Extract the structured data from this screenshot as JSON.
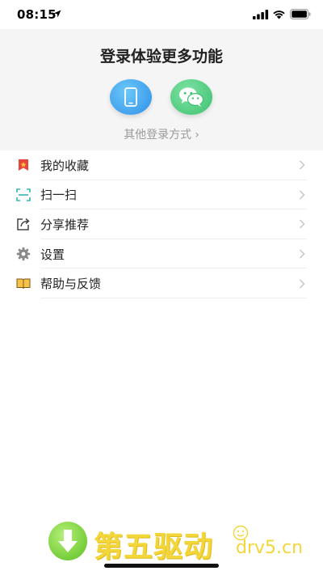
{
  "status_bar": {
    "time": "08:15",
    "icons": [
      "location-arrow-icon",
      "signal-icon",
      "wifi-icon",
      "battery-icon"
    ]
  },
  "login": {
    "title": "登录体验更多功能",
    "phone_icon": "phone-icon",
    "wechat_icon": "wechat-icon",
    "other_methods": "其他登录方式",
    "chevron": "›"
  },
  "menu": {
    "items": [
      {
        "label": "我的收藏",
        "icon": "bookmark-icon"
      },
      {
        "label": "扫一扫",
        "icon": "scan-icon"
      },
      {
        "label": "分享推荐",
        "icon": "share-icon"
      },
      {
        "label": "设置",
        "icon": "gear-icon"
      },
      {
        "label": "帮助与反馈",
        "icon": "book-icon"
      }
    ]
  },
  "watermark": {
    "brand": "第五驱动",
    "url": "drv5.cn"
  },
  "colors": {
    "header_bg": "#f5f5f5",
    "phone_blue": "#2f8fe8",
    "wechat_green": "#3cc06e",
    "bookmark_red": "#e8453c",
    "scan_teal": "#35b7b0",
    "watermark_yellow": "#f3d63a"
  }
}
